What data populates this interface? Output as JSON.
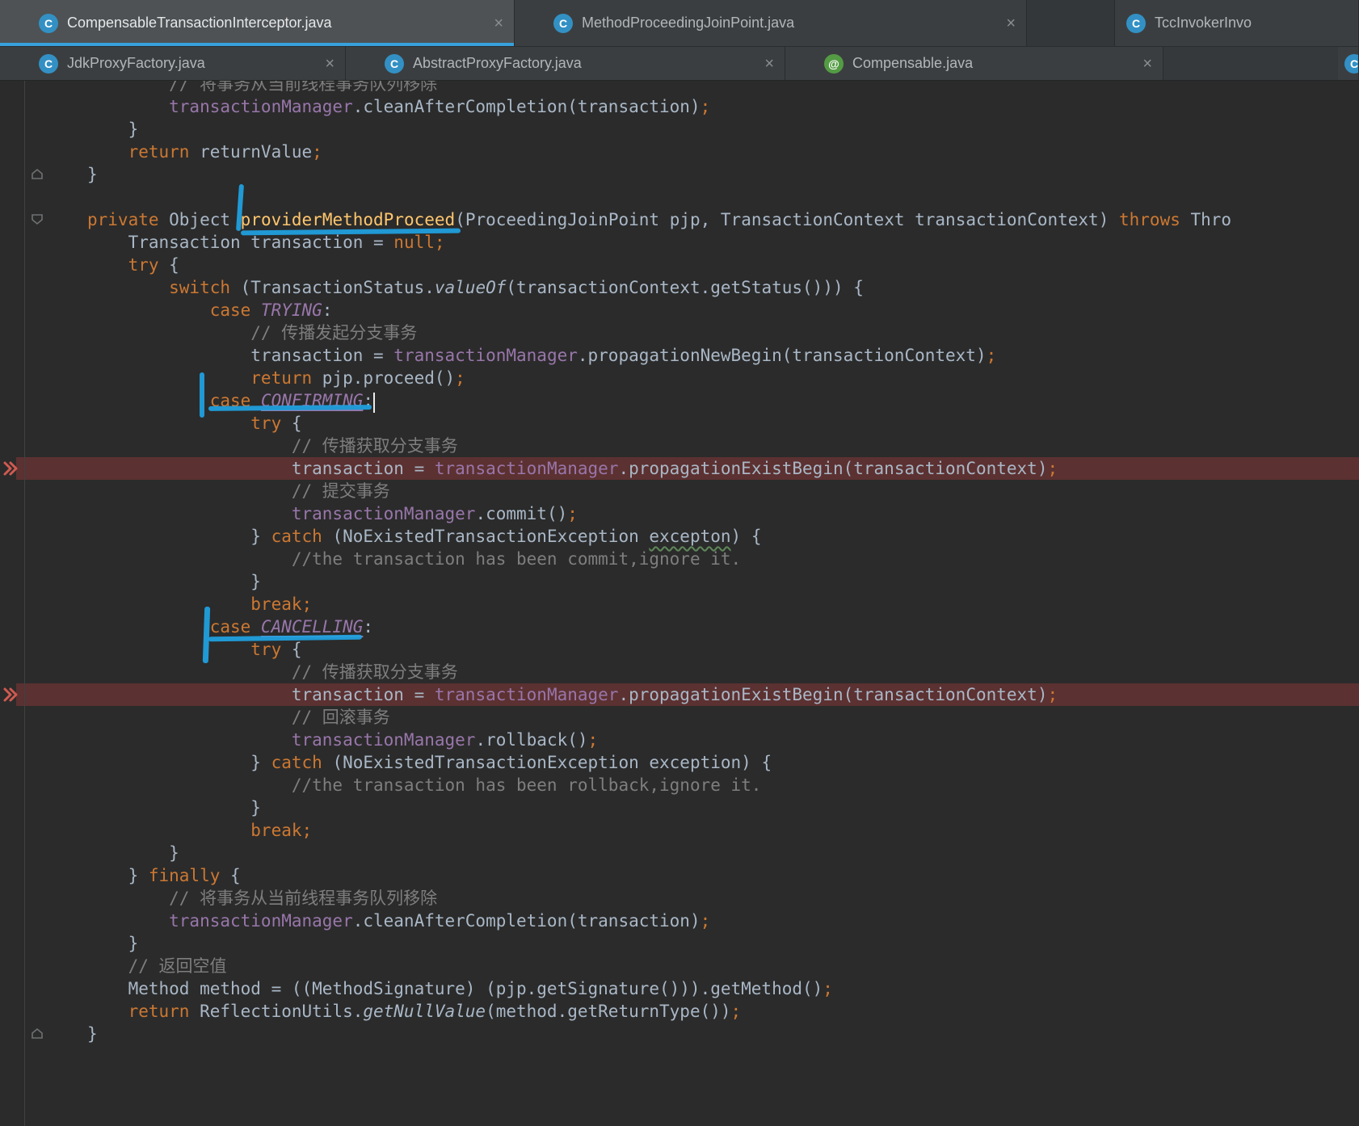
{
  "icons": {
    "close": "×",
    "class_letter": "C",
    "annotation_symbol": "@"
  },
  "colors": {
    "editor_background": "#2B2B2B",
    "tab_active_background": "#4E5254",
    "tab_inactive_background": "#3B3E40",
    "active_tab_underline": "#38A0DC",
    "annotation_stroke": "#1FA3E3",
    "highlighted_line": "#5C3131",
    "change_marker": "#D05A50",
    "keyword": "#CC7832",
    "field": "#9876AA",
    "comment": "#7E7E7E",
    "method_declaration": "#FFC66D",
    "default_text": "#A9B7C6",
    "class_icon": "#3390C4",
    "annotation_icon": "#549C44"
  },
  "tab_rows": [
    {
      "tabs": [
        {
          "label": "CompensableTransactionInterceptor.java",
          "icon": "class",
          "active": true,
          "close": true
        },
        {
          "label": "MethodProceedingJoinPoint.java",
          "icon": "class",
          "active": false,
          "close": true
        },
        {
          "label": "TccInvokerInvo",
          "icon": "class",
          "active": false,
          "close": false,
          "clipped": true
        }
      ]
    },
    {
      "tabs": [
        {
          "label": "JdkProxyFactory.java",
          "icon": "class",
          "active": false,
          "close": true
        },
        {
          "label": "AbstractProxyFactory.java",
          "icon": "class",
          "active": false,
          "close": true
        },
        {
          "label": "Compensable.java",
          "icon": "annotation",
          "active": false,
          "close": true
        },
        {
          "label": "",
          "icon": "class",
          "active": false,
          "close": false,
          "clipped": true
        }
      ]
    }
  ],
  "editor": {
    "lines": [
      {
        "ind": 8,
        "t": [
          [
            "c",
            "// 将事务从当前线程事务队列移除"
          ]
        ]
      },
      {
        "ind": 8,
        "t": [
          [
            "f",
            "transactionManager"
          ],
          [
            "d",
            ".cleanAfterCompletion(transaction)"
          ],
          [
            "k",
            ";"
          ]
        ]
      },
      {
        "ind": 4,
        "t": [
          [
            "d",
            "}"
          ]
        ]
      },
      {
        "ind": 4,
        "t": [
          [
            "k",
            "return"
          ],
          [
            "d",
            " returnValue"
          ],
          [
            "k",
            ";"
          ]
        ]
      },
      {
        "ind": 0,
        "t": [
          [
            "d",
            "}"
          ]
        ]
      },
      {
        "ind": 0,
        "t": []
      },
      {
        "ind": 0,
        "t": [
          [
            "k",
            "private"
          ],
          [
            "d",
            " Object "
          ],
          [
            "m",
            "providerMethodProceed"
          ],
          [
            "d",
            "(ProceedingJoinPoint pjp, TransactionContext transactionContext) "
          ],
          [
            "k",
            "throws"
          ],
          [
            "d",
            " Thro"
          ]
        ]
      },
      {
        "ind": 4,
        "t": [
          [
            "d",
            "Transaction transaction = "
          ],
          [
            "k",
            "null;"
          ]
        ]
      },
      {
        "ind": 4,
        "t": [
          [
            "k",
            "try"
          ],
          [
            "d",
            " {"
          ]
        ]
      },
      {
        "ind": 8,
        "t": [
          [
            "k",
            "switch"
          ],
          [
            "d",
            " (TransactionStatus."
          ],
          [
            "i",
            "valueOf"
          ],
          [
            "d",
            "(transactionContext.getStatus())) {"
          ]
        ]
      },
      {
        "ind": 12,
        "t": [
          [
            "k",
            "case "
          ],
          [
            "e",
            "TRYING"
          ],
          [
            "d",
            ":"
          ]
        ]
      },
      {
        "ind": 16,
        "t": [
          [
            "c",
            "// 传播发起分支事务"
          ]
        ]
      },
      {
        "ind": 16,
        "t": [
          [
            "d",
            "transaction = "
          ],
          [
            "f",
            "transactionManager"
          ],
          [
            "d",
            ".propagationNewBegin(transactionContext)"
          ],
          [
            "k",
            ";"
          ]
        ]
      },
      {
        "ind": 16,
        "t": [
          [
            "k",
            "return"
          ],
          [
            "d",
            " pjp.proceed()"
          ],
          [
            "k",
            ";"
          ]
        ]
      },
      {
        "ind": 12,
        "t": [
          [
            "k",
            "case "
          ],
          [
            "eu",
            "CONFIRMING"
          ],
          [
            "d",
            ":"
          ]
        ]
      },
      {
        "ind": 16,
        "t": [
          [
            "k",
            "try"
          ],
          [
            "d",
            " {"
          ]
        ]
      },
      {
        "ind": 20,
        "t": [
          [
            "c",
            "// 传播获取分支事务"
          ]
        ]
      },
      {
        "ind": 20,
        "hl": 1,
        "t": [
          [
            "d",
            "transaction = "
          ],
          [
            "f",
            "transactionManager"
          ],
          [
            "d",
            ".propagationExistBegin(transactionContext)"
          ],
          [
            "k",
            ";"
          ]
        ]
      },
      {
        "ind": 20,
        "t": [
          [
            "c",
            "// 提交事务"
          ]
        ]
      },
      {
        "ind": 20,
        "t": [
          [
            "f",
            "transactionManager"
          ],
          [
            "d",
            ".commit()"
          ],
          [
            "k",
            ";"
          ]
        ]
      },
      {
        "ind": 16,
        "t": [
          [
            "d",
            "} "
          ],
          [
            "k",
            "catch"
          ],
          [
            "d",
            " (NoExistedTransactionException "
          ],
          [
            "t",
            "excepton"
          ],
          [
            "d",
            ") {"
          ]
        ]
      },
      {
        "ind": 20,
        "t": [
          [
            "c",
            "//the transaction has been commit,ignore it."
          ]
        ]
      },
      {
        "ind": 16,
        "t": [
          [
            "d",
            "}"
          ]
        ]
      },
      {
        "ind": 16,
        "t": [
          [
            "k",
            "break;"
          ]
        ]
      },
      {
        "ind": 12,
        "t": [
          [
            "k",
            "case "
          ],
          [
            "eu",
            "CANCELLING"
          ],
          [
            "d",
            ":"
          ]
        ]
      },
      {
        "ind": 16,
        "t": [
          [
            "k",
            "try"
          ],
          [
            "d",
            " {"
          ]
        ]
      },
      {
        "ind": 20,
        "t": [
          [
            "c",
            "// 传播获取分支事务"
          ]
        ]
      },
      {
        "ind": 20,
        "hl": 1,
        "t": [
          [
            "d",
            "transaction = "
          ],
          [
            "f",
            "transactionManager"
          ],
          [
            "d",
            ".propagationExistBegin(transactionContext)"
          ],
          [
            "k",
            ";"
          ]
        ]
      },
      {
        "ind": 20,
        "t": [
          [
            "c",
            "// 回滚事务"
          ]
        ]
      },
      {
        "ind": 20,
        "t": [
          [
            "f",
            "transactionManager"
          ],
          [
            "d",
            ".rollback()"
          ],
          [
            "k",
            ";"
          ]
        ]
      },
      {
        "ind": 16,
        "t": [
          [
            "d",
            "} "
          ],
          [
            "k",
            "catch"
          ],
          [
            "d",
            " (NoExistedTransactionException exception) {"
          ]
        ]
      },
      {
        "ind": 20,
        "t": [
          [
            "c",
            "//the transaction has been rollback,ignore it."
          ]
        ]
      },
      {
        "ind": 16,
        "t": [
          [
            "d",
            "}"
          ]
        ]
      },
      {
        "ind": 16,
        "t": [
          [
            "k",
            "break;"
          ]
        ]
      },
      {
        "ind": 8,
        "t": [
          [
            "d",
            "}"
          ]
        ]
      },
      {
        "ind": 4,
        "t": [
          [
            "d",
            "} "
          ],
          [
            "k",
            "finally"
          ],
          [
            "d",
            " {"
          ]
        ]
      },
      {
        "ind": 8,
        "t": [
          [
            "c",
            "// 将事务从当前线程事务队列移除"
          ]
        ]
      },
      {
        "ind": 8,
        "t": [
          [
            "f",
            "transactionManager"
          ],
          [
            "d",
            ".cleanAfterCompletion(transaction)"
          ],
          [
            "k",
            ";"
          ]
        ]
      },
      {
        "ind": 4,
        "t": [
          [
            "d",
            "}"
          ]
        ]
      },
      {
        "ind": 4,
        "t": [
          [
            "c",
            "// 返回空值"
          ]
        ]
      },
      {
        "ind": 4,
        "t": [
          [
            "d",
            "Method method = ((MethodSignature) (pjp.getSignature())).getMethod()"
          ],
          [
            "k",
            ";"
          ]
        ]
      },
      {
        "ind": 4,
        "t": [
          [
            "k",
            "return"
          ],
          [
            "d",
            " ReflectionUtils."
          ],
          [
            "i",
            "getNullValue"
          ],
          [
            "d",
            "(method.getReturnType())"
          ],
          [
            "k",
            ";"
          ]
        ]
      },
      {
        "ind": 0,
        "t": [
          [
            "d",
            "}"
          ]
        ]
      }
    ],
    "gutter": {
      "fold_markers": [
        {
          "row": 4,
          "dir": "up"
        },
        {
          "row": 6,
          "dir": "down"
        },
        {
          "row": 42,
          "dir": "up"
        }
      ],
      "change_markers": [
        17,
        27
      ]
    },
    "annotations": [
      {
        "type": "hand-tick",
        "target": "providerMethodProceed"
      },
      {
        "type": "hand-underline",
        "target": "providerMethodProceed"
      },
      {
        "type": "hand-vertical",
        "target": "case CONFIRMING:"
      },
      {
        "type": "hand-underline",
        "target": "case CONFIRMING:"
      },
      {
        "type": "hand-vertical",
        "target": "case CANCELLING:"
      },
      {
        "type": "hand-underline",
        "target": "case CANCELLING:"
      },
      {
        "type": "caret-after",
        "target": "case CONFIRMING:"
      }
    ]
  }
}
